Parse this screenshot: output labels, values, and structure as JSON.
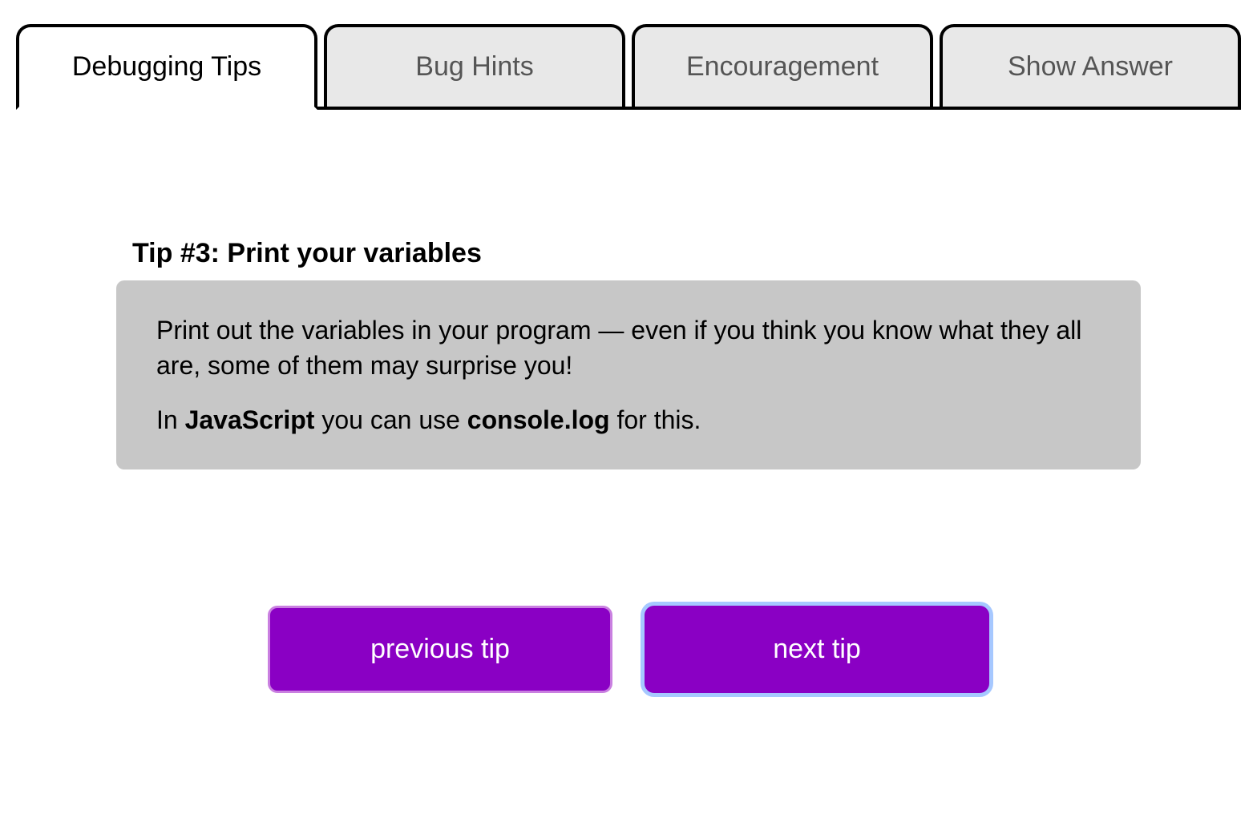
{
  "tabs": [
    {
      "label": "Debugging Tips",
      "active": true
    },
    {
      "label": "Bug Hints",
      "active": false
    },
    {
      "label": "Encouragement",
      "active": false
    },
    {
      "label": "Show Answer",
      "active": false
    }
  ],
  "tip": {
    "title": "Tip #3: Print your variables",
    "para1": "Print out the variables in your program — even if you think you know what they all are, some of them may surprise you!",
    "para2_prefix": "In ",
    "para2_bold1": "JavaScript",
    "para2_mid": " you can use ",
    "para2_bold2": "console.log",
    "para2_suffix": " for this."
  },
  "buttons": {
    "prev": "previous tip",
    "next": "next tip"
  }
}
